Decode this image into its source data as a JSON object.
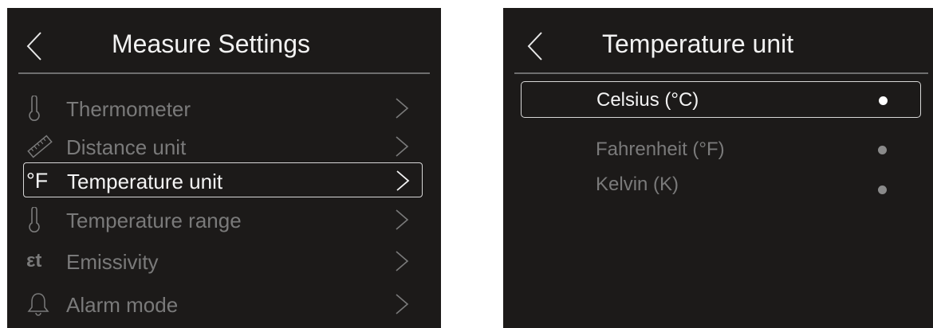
{
  "left_panel": {
    "title": "Measure Settings",
    "items": [
      {
        "label": "Thermometer",
        "icon": "thermometer-icon"
      },
      {
        "label": "Distance unit",
        "icon": "ruler-icon"
      },
      {
        "label": "Temperature unit",
        "icon": "fahrenheit-icon",
        "icon_text": "°F",
        "selected": true
      },
      {
        "label": "Temperature range",
        "icon": "thermometer-icon"
      },
      {
        "label": "Emissivity",
        "icon": "emissivity-icon",
        "icon_text": "εt"
      },
      {
        "label": "Alarm mode",
        "icon": "bell-icon"
      }
    ]
  },
  "right_panel": {
    "title": "Temperature unit",
    "options": [
      {
        "label": "Celsius (°C)",
        "selected": true
      },
      {
        "label": "Fahrenheit (°F)",
        "selected": false
      },
      {
        "label": "Kelvin (K)",
        "selected": false
      }
    ]
  },
  "colors": {
    "panel_bg": "#1c1a19",
    "text_active": "#f4f4f4",
    "text_inactive": "#7a7a7a",
    "selection_border": "#d8d8d8"
  }
}
